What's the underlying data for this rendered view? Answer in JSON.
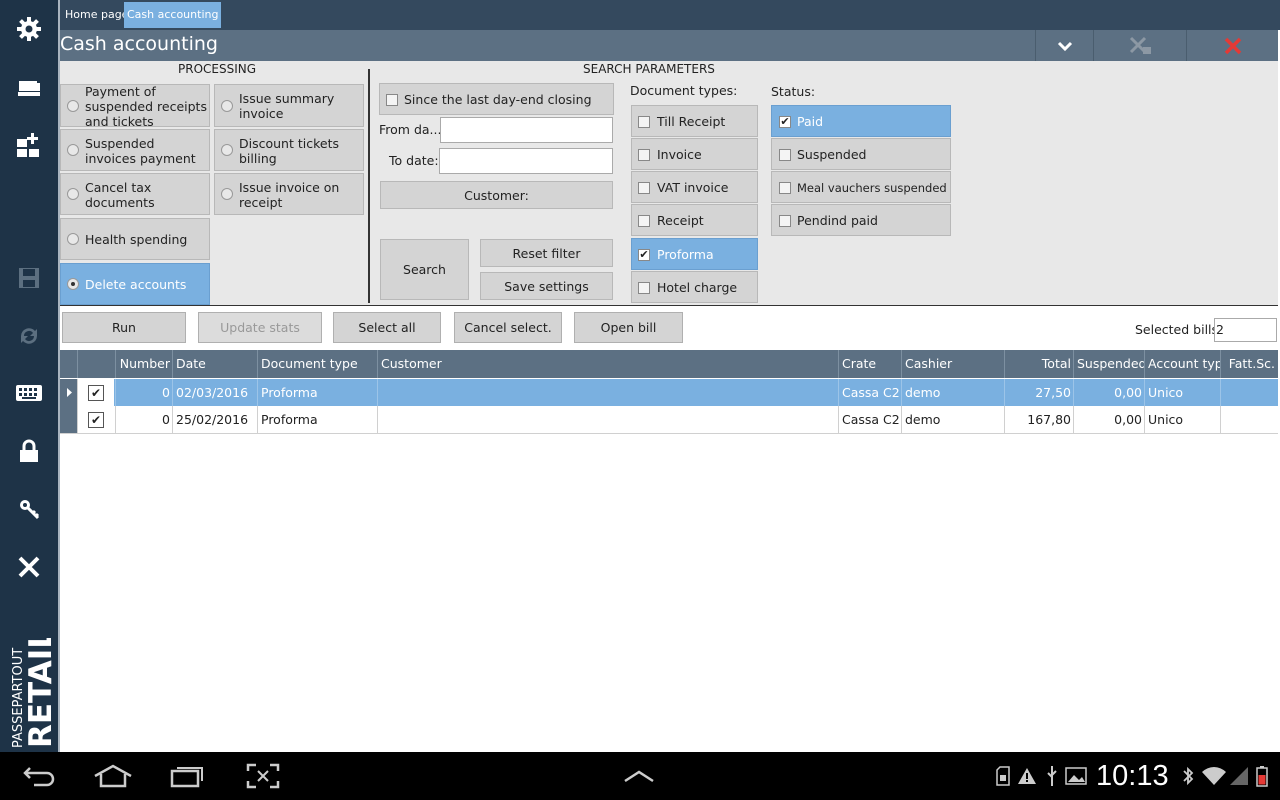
{
  "tabs": {
    "home": "Home page",
    "active": "Cash accounting"
  },
  "title": "Cash accounting",
  "processing": {
    "heading": "PROCESSING",
    "options": [
      "Payment of suspended receipts and tickets",
      "Issue summary invoice",
      "Suspended invoices payment",
      "Discount tickets billing",
      "Cancel tax documents",
      "Issue invoice on receipt",
      "Health spending",
      "Delete accounts"
    ],
    "selected": "Delete accounts"
  },
  "search": {
    "heading": "SEARCH PARAMETERS",
    "since_last": "Since the last day-end closing",
    "from_label": "From da...",
    "to_label": "To date:",
    "from_value": "",
    "to_value": "",
    "customer_btn": "Customer:",
    "search_btn": "Search",
    "reset_btn": "Reset filter",
    "save_btn": "Save settings"
  },
  "doc_types": {
    "heading": "Document types:",
    "items": [
      "Till Receipt",
      "Invoice",
      "VAT invoice",
      "Receipt",
      "Proforma",
      "Hotel charge"
    ],
    "checked": [
      "Proforma"
    ]
  },
  "status": {
    "heading": "Status:",
    "items": [
      "Paid",
      "Suspended",
      "Meal vauchers suspended",
      "Pendind paid"
    ],
    "checked": [
      "Paid"
    ]
  },
  "actions": {
    "run": "Run",
    "update_stats": "Update stats",
    "select_all": "Select all",
    "cancel_select": "Cancel select.",
    "open_bill": "Open bill",
    "selected_bills_label": "Selected bills:",
    "selected_bills_value": "2"
  },
  "grid": {
    "columns": [
      "Number",
      "Date",
      "Document type",
      "Customer",
      "Crate",
      "Cashier",
      "Total",
      "Suspended",
      "Account type",
      "Fatt.Sc."
    ],
    "rows": [
      {
        "number": "0",
        "date": "02/03/2016",
        "doctype": "Proforma",
        "customer": "",
        "crate": "Cassa C2",
        "cashier": "demo",
        "total": "27,50",
        "suspended": "0,00",
        "account": "Unico",
        "fatt": ""
      },
      {
        "number": "0",
        "date": "25/02/2016",
        "doctype": "Proforma",
        "customer": "",
        "crate": "Cassa C2",
        "cashier": "demo",
        "total": "167,80",
        "suspended": "0,00",
        "account": "Unico",
        "fatt": ""
      }
    ]
  },
  "brand": {
    "line1": "PASSEPARTOUT",
    "line2": "RETAIL"
  },
  "clock": "10:13",
  "colors": {
    "sidebar": "#1e3347",
    "titlebar": "#5c7083",
    "accent": "#7ab0e0",
    "close": "#e53935"
  }
}
